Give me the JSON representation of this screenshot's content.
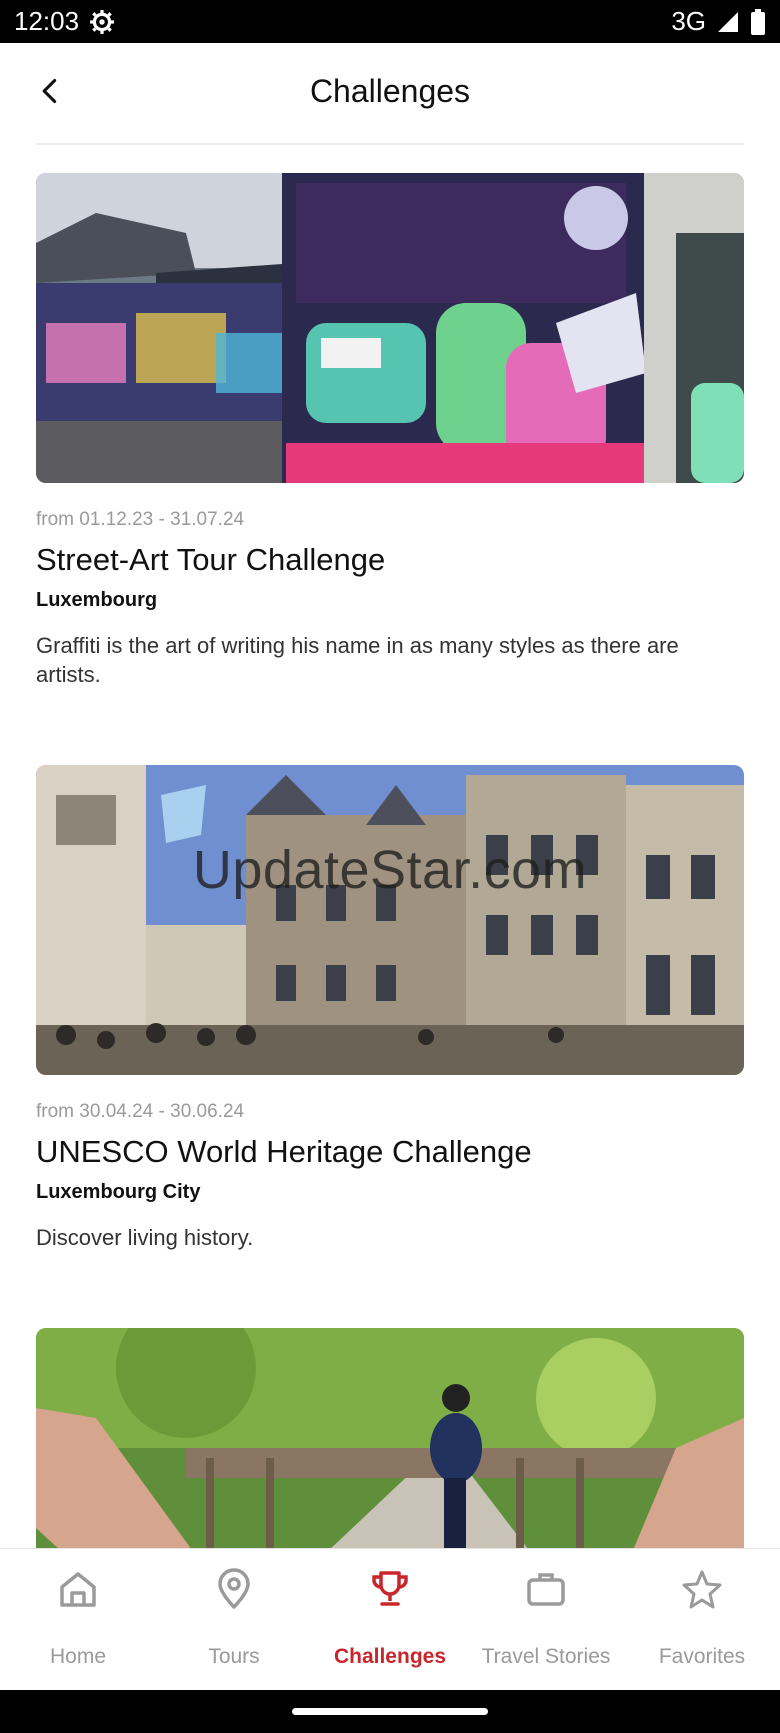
{
  "status_bar": {
    "time": "12:03",
    "network": "3G",
    "icons": [
      "settings-gear-icon",
      "signal-icon",
      "battery-icon"
    ]
  },
  "header": {
    "title": "Challenges",
    "back_icon": "chevron-left-icon"
  },
  "cards": [
    {
      "date": "from 01.12.23 - 31.07.24",
      "title": "Street-Art Tour Challenge",
      "location": "Luxembourg",
      "description": "Graffiti is the art of writing his name in as many styles as there are artists."
    },
    {
      "date": "from 30.04.24 - 30.06.24",
      "title": "UNESCO World Heritage Challenge",
      "location": "Luxembourg City",
      "description": "Discover living history.",
      "watermark": "UpdateStar.com"
    },
    {
      "image_only": true
    }
  ],
  "bottom_nav": {
    "items": [
      {
        "label": "Home",
        "icon": "home-icon"
      },
      {
        "label": "Tours",
        "icon": "map-pin-icon"
      },
      {
        "label": "Challenges",
        "icon": "trophy-icon",
        "active": true
      },
      {
        "label": "Travel Stories",
        "icon": "briefcase-icon"
      },
      {
        "label": "Favorites",
        "icon": "star-icon"
      }
    ],
    "active_color": "#c8262a",
    "inactive_color": "#9a9a9a"
  }
}
